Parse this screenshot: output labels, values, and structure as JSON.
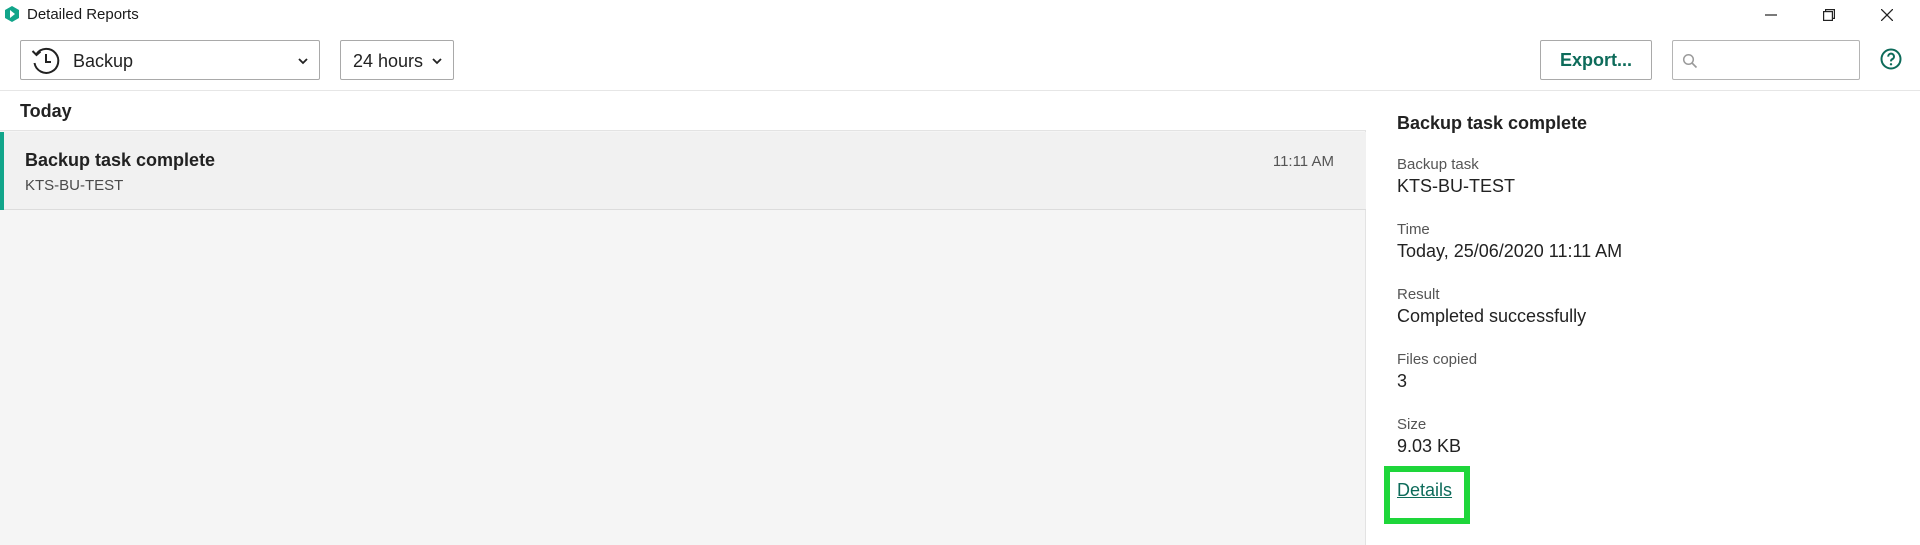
{
  "window": {
    "title": "Detailed Reports"
  },
  "toolbar": {
    "type_select_value": "Backup",
    "range_select_value": "24 hours",
    "export_label": "Export...",
    "search_placeholder": ""
  },
  "list": {
    "group_label": "Today",
    "items": [
      {
        "title": "Backup task complete",
        "subtitle": "KTS-BU-TEST",
        "time": "11:11 AM"
      }
    ]
  },
  "details": {
    "title": "Backup task complete",
    "fields": [
      {
        "label": "Backup task",
        "value": "KTS-BU-TEST"
      },
      {
        "label": "Time",
        "value": "Today, 25/06/2020 11:11 AM"
      },
      {
        "label": "Result",
        "value": "Completed successfully"
      },
      {
        "label": "Files copied",
        "value": "3"
      },
      {
        "label": "Size",
        "value": "9.03 KB"
      }
    ],
    "details_link_label": "Details"
  },
  "colors": {
    "accent": "#11a58a",
    "link": "#0d6b5a",
    "highlight": "#1ed63a"
  }
}
